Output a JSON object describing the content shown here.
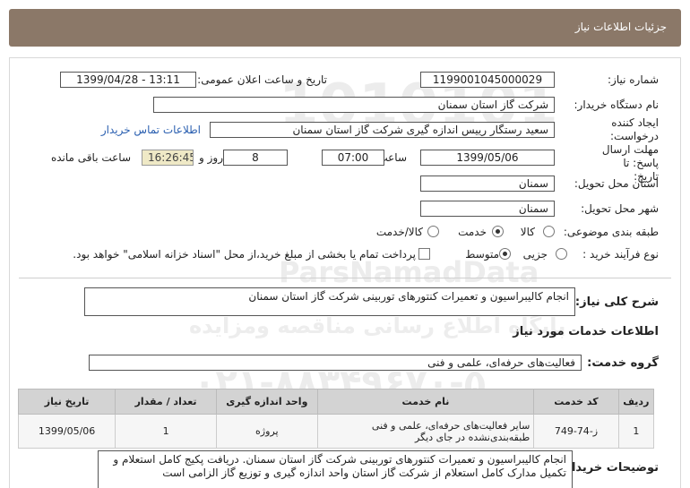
{
  "header": {
    "title": "جزئیات اطلاعات نیاز"
  },
  "watermark": {
    "line1": "1010101",
    "line2": "ParsNamadData",
    "line3": "مرکز فراوری اطلاعات پارس نماد داده ها",
    "line4": "پایگاه اطلاع رسانی مناقصه ومزایده",
    "line5": "۰۲۱-۸۸۳۴۹۶۷۰-۵",
    "line6": ""
  },
  "fields": {
    "need_number_label": "شماره نیاز:",
    "need_number": "1199001045000029",
    "announce_label": "تاریخ و ساعت اعلان عمومی:",
    "announce_value": "1399/04/28 - 13:11",
    "buyer_label": "نام دستگاه خریدار:",
    "buyer_value": "شرکت گاز استان سمنان",
    "creator_label": "ایجاد کننده درخواست:",
    "creator_value": "سعید رستگار رییس اندازه گیری شرکت گاز استان سمنان",
    "contact_link": "اطلاعات تماس خریدار",
    "deadline_label": "مهلت ارسال پاسخ: تا تاریخ:",
    "deadline_date": "1399/05/06",
    "time_label": "ساعت",
    "deadline_time": "07:00",
    "days_value": "8",
    "days_label": "روز و",
    "remaining_time": "16:26:45",
    "remaining_label": "ساعت باقی مانده",
    "province_label": "استان محل تحویل:",
    "province_value": "سمنان",
    "city_label": "شهر محل تحویل:",
    "city_value": "سمنان",
    "category_label": "طبقه بندی موضوعی:",
    "category_options": [
      "کالا",
      "خدمت",
      "کالا/خدمت"
    ],
    "process_label": "نوع فرآیند خرید :",
    "process_options": [
      "جزیی",
      "متوسط"
    ],
    "payment_note": "پرداخت تمام یا بخشی از مبلغ خرید،از محل \"اسناد خزانه اسلامی\" خواهد بود."
  },
  "summary": {
    "label": "شرح کلی نیاز:",
    "value": "انجام کالیبراسیون و تعمیرات کنتورهای توربینی شرکت گاز استان سمنان"
  },
  "services_section": {
    "title": "اطلاعات خدمات مورد نیاز"
  },
  "service_group": {
    "label": "گروه خدمت:",
    "value": "فعالیت‌های حرفه‌ای، علمی و فنی"
  },
  "table": {
    "headers": [
      "ردیف",
      "کد خدمت",
      "نام خدمت",
      "واحد اندازه گیری",
      "تعداد / مقدار",
      "تاریخ نیاز"
    ],
    "rows": [
      [
        "1",
        "ز-74-749",
        "سایر فعالیت‌های حرفه‌ای، علمی و فنی طبقه‌بندی‌نشده در جای دیگر",
        "پروژه",
        "1",
        "1399/05/06"
      ]
    ]
  },
  "buyer_notes": {
    "label": "توضیحات خریدار:",
    "value": "انجام کالیبراسیون و تعمیرات کنتورهای توربینی شرکت گاز استان سمنان. دریافت پکیج کامل استعلام و تکمیل مدارک کامل استعلام از شرکت گاز استان واحد اندازه گیری و توزیع گاز الزامی است"
  }
}
